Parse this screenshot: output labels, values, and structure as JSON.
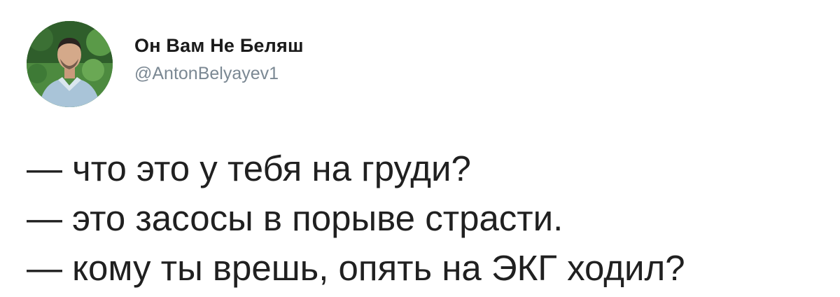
{
  "author": {
    "name": "Он Вам Не Беляш",
    "handle": "@AntonBelyayev1",
    "avatar_icon": "profile-photo"
  },
  "tweet": {
    "lines": [
      "— что это у тебя на груди?",
      "— это засосы в порыве страсти.",
      "— кому ты врешь, опять на ЭКГ ходил?"
    ]
  }
}
